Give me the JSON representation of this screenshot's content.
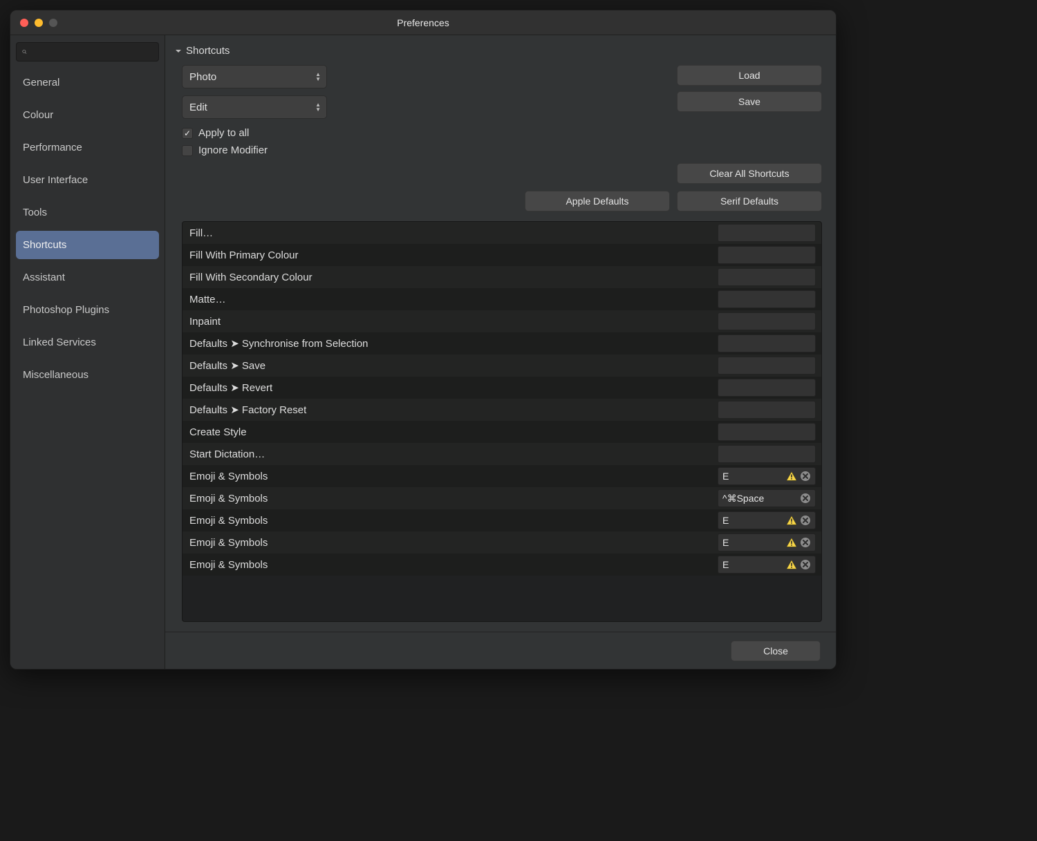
{
  "window": {
    "title": "Preferences"
  },
  "sidebar": {
    "items": [
      {
        "label": "General"
      },
      {
        "label": "Colour"
      },
      {
        "label": "Performance"
      },
      {
        "label": "User Interface"
      },
      {
        "label": "Tools"
      },
      {
        "label": "Shortcuts",
        "selected": true
      },
      {
        "label": "Assistant"
      },
      {
        "label": "Photoshop Plugins"
      },
      {
        "label": "Linked Services"
      },
      {
        "label": "Miscellaneous"
      }
    ]
  },
  "section": {
    "title": "Shortcuts"
  },
  "popups": {
    "persona": "Photo",
    "menu": "Edit"
  },
  "buttons": {
    "load": "Load",
    "save": "Save",
    "clear_all": "Clear All Shortcuts",
    "apple_defaults": "Apple Defaults",
    "serif_defaults": "Serif Defaults",
    "close": "Close"
  },
  "checks": {
    "apply_all": {
      "label": "Apply to all",
      "checked": true
    },
    "ignore_modifier": {
      "label": "Ignore Modifier",
      "checked": false
    }
  },
  "shortcuts": [
    {
      "label": "Fill…",
      "value": "",
      "warn": false,
      "clear": false
    },
    {
      "label": "Fill With Primary Colour",
      "value": "",
      "warn": false,
      "clear": false
    },
    {
      "label": "Fill With Secondary Colour",
      "value": "",
      "warn": false,
      "clear": false
    },
    {
      "label": "Matte…",
      "value": "",
      "warn": false,
      "clear": false
    },
    {
      "label": "Inpaint",
      "value": "",
      "warn": false,
      "clear": false
    },
    {
      "label": "Defaults ➤ Synchronise from Selection",
      "value": "",
      "warn": false,
      "clear": false
    },
    {
      "label": "Defaults ➤ Save",
      "value": "",
      "warn": false,
      "clear": false
    },
    {
      "label": "Defaults ➤ Revert",
      "value": "",
      "warn": false,
      "clear": false
    },
    {
      "label": "Defaults ➤ Factory Reset",
      "value": "",
      "warn": false,
      "clear": false
    },
    {
      "label": "Create Style",
      "value": "",
      "warn": false,
      "clear": false
    },
    {
      "label": "Start Dictation…",
      "value": "",
      "warn": false,
      "clear": false
    },
    {
      "label": "Emoji & Symbols",
      "value": "E",
      "warn": true,
      "clear": true
    },
    {
      "label": "Emoji & Symbols",
      "value": "^⌘Space",
      "warn": false,
      "clear": true
    },
    {
      "label": "Emoji & Symbols",
      "value": "E",
      "warn": true,
      "clear": true
    },
    {
      "label": "Emoji & Symbols",
      "value": "E",
      "warn": true,
      "clear": true
    },
    {
      "label": "Emoji & Symbols",
      "value": "E",
      "warn": true,
      "clear": true
    }
  ]
}
